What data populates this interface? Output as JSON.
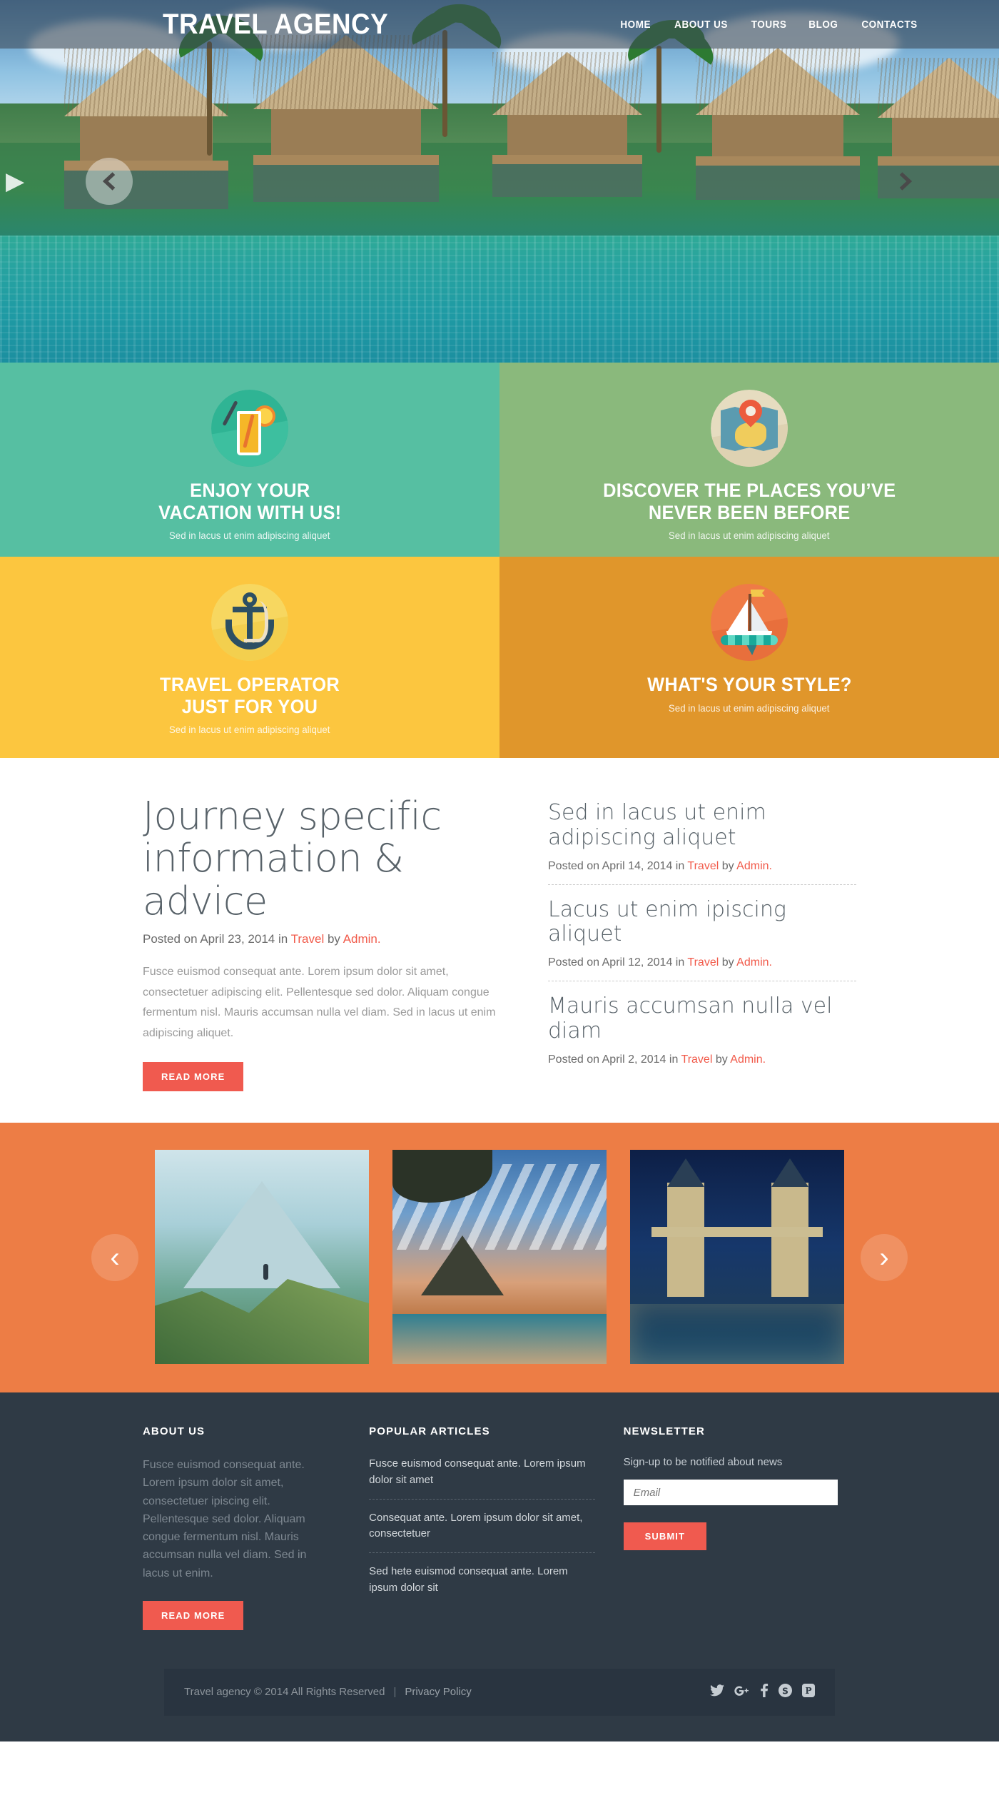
{
  "header": {
    "logo": "TRAVEL AGENCY",
    "nav": [
      {
        "label": "HOME"
      },
      {
        "label": "ABOUT US"
      },
      {
        "label": "TOURS"
      },
      {
        "label": "BLOG"
      },
      {
        "label": "CONTACTS"
      }
    ]
  },
  "hero": {
    "prev_label": "‹",
    "next_label": "›",
    "edge_left_label": "▶"
  },
  "features": [
    {
      "icon": "cocktail-icon",
      "title": "ENJOY YOUR\nVACATION WITH US!",
      "title_line1": "ENJOY YOUR",
      "title_line2": "VACATION WITH US!",
      "subtitle": "Sed in lacus ut enim adipiscing aliquet",
      "bg": "#56bfa2"
    },
    {
      "icon": "map-pin-icon",
      "title_line1": "DISCOVER THE PLACES YOU’VE",
      "title_line2": "NEVER BEEN BEFORE",
      "subtitle": "Sed in lacus ut enim adipiscing aliquet",
      "bg": "#8ab97c"
    },
    {
      "icon": "anchor-icon",
      "title_line1": "TRAVEL OPERATOR",
      "title_line2": "JUST FOR YOU",
      "subtitle": "Sed in lacus ut enim adipiscing aliquet",
      "bg": "#fcc63f"
    },
    {
      "icon": "sailboat-icon",
      "title_line1": "WHAT'S YOUR STYLE?",
      "title_line2": "",
      "subtitle": "Sed in lacus ut enim adipiscing aliquet",
      "bg": "#e0962b"
    }
  ],
  "main": {
    "post": {
      "title": "Journey specific information & advice",
      "meta_prefix": "Posted on April 23, 2014 in ",
      "meta_category": "Travel",
      "meta_by": "  by ",
      "meta_author": "Admin.",
      "body": "Fusce euismod consequat ante. Lorem ipsum dolor sit amet, consectetuer adipiscing elit. Pellentesque sed dolor. Aliquam congue fermentum nisl. Mauris accumsan nulla vel diam. Sed in lacus ut enim adipiscing aliquet.",
      "read_more": "READ MORE"
    },
    "side_posts": [
      {
        "title": "Sed in lacus ut enim adipiscing aliquet",
        "meta_prefix": "Posted on April 14, 2014 in ",
        "meta_category": "Travel",
        "meta_by": "  by ",
        "meta_author": "Admin."
      },
      {
        "title": "Lacus ut enim ipiscing aliquet",
        "meta_prefix": "Posted on April 12, 2014 in ",
        "meta_category": "Travel",
        "meta_by": "  by ",
        "meta_author": "Admin."
      },
      {
        "title": "Mauris accumsan nulla vel diam",
        "meta_prefix": "Posted on April 2, 2014 in ",
        "meta_category": "Travel",
        "meta_by": "  by ",
        "meta_author": "Admin."
      }
    ]
  },
  "gallery": {
    "prev_label": "‹",
    "next_label": "›",
    "items": [
      {
        "alt": "mountain-hiker-photo"
      },
      {
        "alt": "tropical-beach-resort-photo"
      },
      {
        "alt": "tower-bridge-night-photo"
      }
    ]
  },
  "footer": {
    "about": {
      "heading": "ABOUT US",
      "text": "Fusce euismod consequat ante. Lorem ipsum dolor sit amet, consectetuer ipiscing elit. Pellentesque sed dolor. Aliquam congue fermentum nisl. Mauris accumsan nulla vel diam. Sed in lacus ut enim.",
      "read_more": "READ MORE"
    },
    "popular": {
      "heading": "POPULAR ARTICLES",
      "items": [
        {
          "text": "Fusce euismod consequat ante. Lorem ipsum dolor sit amet"
        },
        {
          "text": "Consequat ante. Lorem ipsum dolor sit amet, consectetuer"
        },
        {
          "text": "Sed hete euismod consequat ante. Lorem ipsum dolor sit"
        }
      ]
    },
    "newsletter": {
      "heading": "NEWSLETTER",
      "note": "Sign-up to be notified about news",
      "email_placeholder": "Email",
      "email_value": "",
      "submit": "SUBMIT"
    },
    "copyright": {
      "text": "Travel agency © 2014 All Rights Reserved",
      "separator": "|",
      "privacy": "Privacy Policy"
    },
    "socials": [
      {
        "name": "twitter-icon",
        "glyph": "ᵕ"
      },
      {
        "name": "google-plus-icon",
        "glyph": "g+"
      },
      {
        "name": "facebook-icon",
        "glyph": "f"
      },
      {
        "name": "skype-icon",
        "glyph": "S"
      },
      {
        "name": "pinterest-icon",
        "glyph": "P"
      }
    ]
  },
  "colors": {
    "accent_red": "#f05a4f",
    "teal": "#56bfa2",
    "green": "#8ab97c",
    "yellow": "#fcc63f",
    "orange": "#e0962b",
    "gallery_orange": "#ed7d45",
    "footer_dark": "#2f3a45"
  }
}
